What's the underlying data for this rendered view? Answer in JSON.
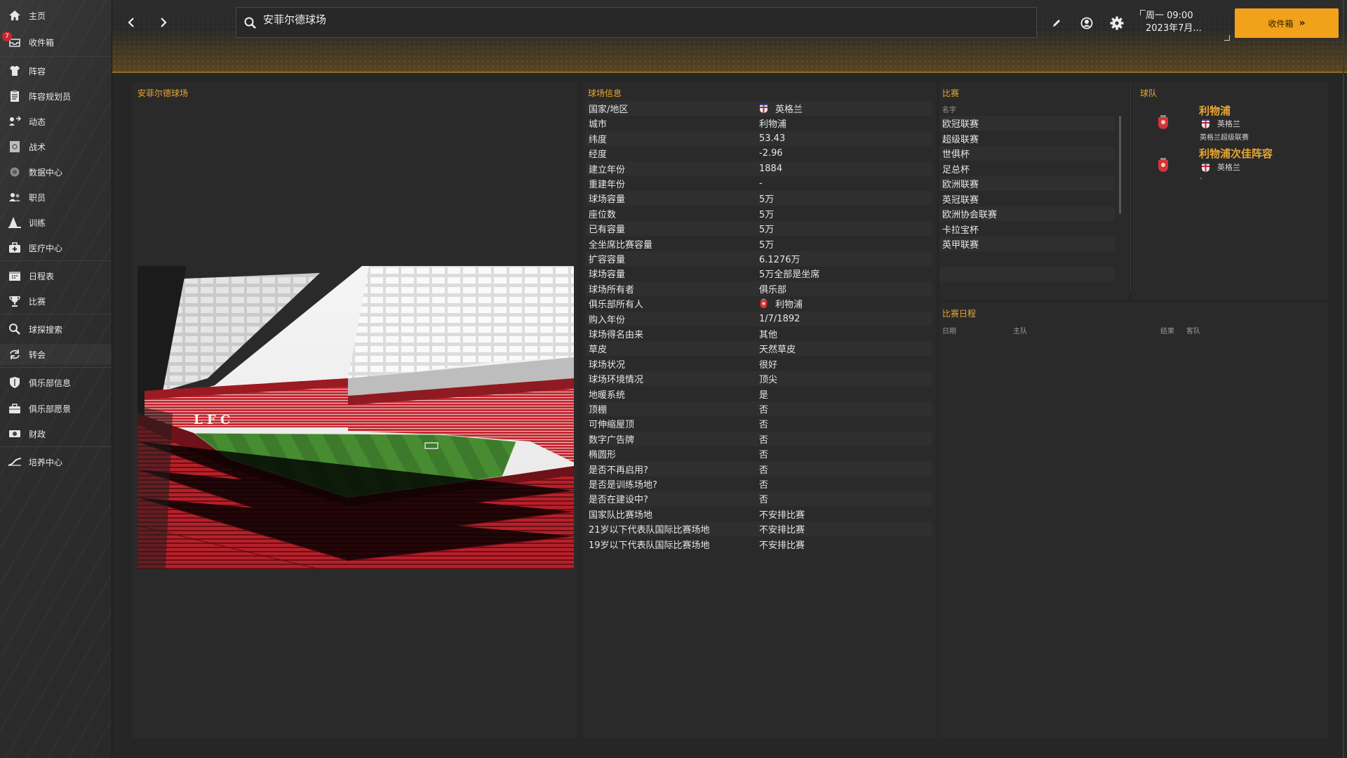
{
  "sidebar": {
    "items": [
      {
        "label": "主页",
        "icon": "home-icon"
      },
      {
        "label": "收件箱",
        "icon": "inbox-icon",
        "badge": "7"
      },
      {
        "label": "阵容",
        "icon": "squad-shirt-icon"
      },
      {
        "label": "阵容规划员",
        "icon": "clipboard-icon"
      },
      {
        "label": "动态",
        "icon": "dynamics-icon"
      },
      {
        "label": "战术",
        "icon": "tactics-board-icon"
      },
      {
        "label": "数据中心",
        "icon": "data-hub-icon"
      },
      {
        "label": "职员",
        "icon": "staff-icon"
      },
      {
        "label": "训练",
        "icon": "training-cone-icon"
      },
      {
        "label": "医疗中心",
        "icon": "medical-kit-icon"
      },
      {
        "label": "日程表",
        "icon": "calendar-icon"
      },
      {
        "label": "比赛",
        "icon": "trophy-icon"
      },
      {
        "label": "球探搜索",
        "icon": "search-icon"
      },
      {
        "label": "转会",
        "icon": "transfer-arrows-icon"
      },
      {
        "label": "俱乐部信息",
        "icon": "club-shield-icon"
      },
      {
        "label": "俱乐部愿景",
        "icon": "briefcase-icon"
      },
      {
        "label": "财政",
        "icon": "finance-icon"
      },
      {
        "label": "培养中心",
        "icon": "development-icon"
      }
    ]
  },
  "header": {
    "search_value": "安菲尔德球场",
    "date_line1": "周一 09:00",
    "date_line2": "2023年7月...",
    "continue_label": "收件箱"
  },
  "colors": {
    "accent": "#e8a832",
    "button": "#f2a21a",
    "panel": "#2a2a2a",
    "background": "#262626"
  },
  "left_panel": {
    "title": "安菲尔德球场"
  },
  "stadium_info": {
    "title": "球场信息",
    "rows": [
      {
        "label": "国家/地区",
        "value": "英格兰",
        "flag": "england"
      },
      {
        "label": "城市",
        "value": "利物浦"
      },
      {
        "label": "纬度",
        "value": "53.43"
      },
      {
        "label": "经度",
        "value": "-2.96"
      },
      {
        "label": "建立年份",
        "value": "1884"
      },
      {
        "label": "重建年份",
        "value": "-"
      },
      {
        "label": "球场容量",
        "value": "5万"
      },
      {
        "label": "座位数",
        "value": "5万"
      },
      {
        "label": "已有容量",
        "value": "5万"
      },
      {
        "label": "全坐席比赛容量",
        "value": "5万"
      },
      {
        "label": "扩容容量",
        "value": "6.1276万"
      },
      {
        "label": "球场容量",
        "value": "5万全部是坐席"
      },
      {
        "label": "球场所有者",
        "value": "俱乐部"
      },
      {
        "label": "俱乐部所有人",
        "value": "利物浦",
        "flag": "liverpool"
      },
      {
        "label": "购入年份",
        "value": "1/7/1892"
      },
      {
        "label": "球场得名由来",
        "value": "其他"
      },
      {
        "label": "草皮",
        "value": "天然草皮"
      },
      {
        "label": "球场状况",
        "value": "很好"
      },
      {
        "label": "球场环境情况",
        "value": "顶尖"
      },
      {
        "label": "地暖系统",
        "value": "是"
      },
      {
        "label": "顶棚",
        "value": "否"
      },
      {
        "label": "可伸缩屋顶",
        "value": "否"
      },
      {
        "label": "数字广告牌",
        "value": "否"
      },
      {
        "label": "椭圆形",
        "value": "否"
      },
      {
        "label": "是否不再启用?",
        "value": "否"
      },
      {
        "label": "是否是训练场地?",
        "value": "否"
      },
      {
        "label": "是否在建设中?",
        "value": "否"
      },
      {
        "label": "国家队比赛场地",
        "value": "不安排比赛"
      },
      {
        "label": "21岁以下代表队国际比赛场地",
        "value": "不安排比赛"
      },
      {
        "label": "19岁以下代表队国际比赛场地",
        "value": "不安排比赛"
      }
    ]
  },
  "competitions": {
    "title": "比赛",
    "column": "名字",
    "items": [
      "欧冠联赛",
      "超级联赛",
      "世俱杯",
      "足总杯",
      "欧洲联赛",
      "英冠联赛",
      "欧洲协会联赛",
      "卡拉宝杯",
      "英甲联赛"
    ]
  },
  "teams": {
    "title": "球队",
    "items": [
      {
        "name": "利物浦",
        "nation": "英格兰",
        "league": "英格兰超级联赛"
      },
      {
        "name": "利物浦次佳阵容",
        "nation": "英格兰",
        "league": "-"
      }
    ]
  },
  "schedule": {
    "title": "比赛日程",
    "columns": {
      "date": "日期",
      "home": "主队",
      "result": "结果",
      "away": "客队"
    }
  },
  "stadium_photo": {
    "roof_letters": "L F C"
  }
}
